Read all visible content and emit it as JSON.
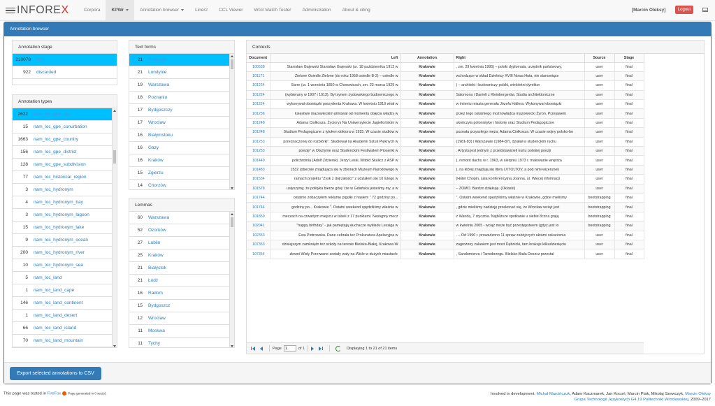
{
  "navbar": {
    "brand": "INFOREX",
    "items": [
      {
        "label": "Corpora"
      },
      {
        "label": "KPWr"
      },
      {
        "label": "Annotation browser"
      },
      {
        "label": "Liner2"
      },
      {
        "label": "CCL Viewer"
      },
      {
        "label": "Wccl Match Tester"
      },
      {
        "label": "Administration"
      },
      {
        "label": "About & citing"
      }
    ],
    "user": "[Marcin Oleksy]",
    "logout": "Logout"
  },
  "panel": {
    "title": "Annotation browser",
    "export_label": "Export selected annotations to CSV"
  },
  "annotation_stage": {
    "title": "Annotation stage",
    "items": [
      {
        "count": "210078",
        "label": "final"
      },
      {
        "count": "922",
        "label": "discarded"
      }
    ]
  },
  "annotation_types": {
    "title": "Annotation types",
    "items": [
      {
        "count": "2622",
        "label": "nam_loc_gpe_city"
      },
      {
        "count": "15",
        "label": "nam_loc_gpe_conurbation"
      },
      {
        "count": "1663",
        "label": "nam_loc_gpe_country"
      },
      {
        "count": "156",
        "label": "nam_loc_gpe_district"
      },
      {
        "count": "128",
        "label": "nam_loc_gpe_subdivision"
      },
      {
        "count": "77",
        "label": "nam_loc_historical_region"
      },
      {
        "count": "3",
        "label": "nam_loc_hydronym"
      },
      {
        "count": "4",
        "label": "nam_loc_hydronym_bay"
      },
      {
        "count": "3",
        "label": "nam_loc_hydronym_lagoon"
      },
      {
        "count": "15",
        "label": "nam_loc_hydronym_lake"
      },
      {
        "count": "9",
        "label": "nam_loc_hydronym_ocean"
      },
      {
        "count": "200",
        "label": "nam_loc_hydronym_river"
      },
      {
        "count": "10",
        "label": "nam_loc_hydronym_sea"
      },
      {
        "count": "5",
        "label": "nam_loc_land"
      },
      {
        "count": "1",
        "label": "nam_loc_land_cape"
      },
      {
        "count": "146",
        "label": "nam_loc_land_continent"
      },
      {
        "count": "1",
        "label": "nam_loc_land_desert"
      },
      {
        "count": "66",
        "label": "nam_loc_land_island"
      },
      {
        "count": "70",
        "label": "nam_loc_land_mountain"
      }
    ]
  },
  "text_forms": {
    "title": "Text forms",
    "items": [
      {
        "count": "21",
        "label": "Krakowie"
      },
      {
        "count": "21",
        "label": "Londynie"
      },
      {
        "count": "19",
        "label": "Warszawa"
      },
      {
        "count": "18",
        "label": "Poznaniu"
      },
      {
        "count": "17",
        "label": "Bydgoszczy"
      },
      {
        "count": "17",
        "label": "Wrocław"
      },
      {
        "count": "16",
        "label": "Białymstoku"
      },
      {
        "count": "16",
        "label": "Gazy"
      },
      {
        "count": "16",
        "label": "Kraków"
      },
      {
        "count": "15",
        "label": "Zgierzu"
      },
      {
        "count": "14",
        "label": "Chorzów"
      }
    ]
  },
  "lemmas": {
    "title": "Lemmas",
    "items": [
      {
        "count": "60",
        "label": "Warszawa"
      },
      {
        "count": "52",
        "label": "Ozorków"
      },
      {
        "count": "27",
        "label": "Lublin"
      },
      {
        "count": "25",
        "label": "Kraków"
      },
      {
        "count": "21",
        "label": "Białystok"
      },
      {
        "count": "21",
        "label": "Łódź"
      },
      {
        "count": "16",
        "label": "Radom"
      },
      {
        "count": "15",
        "label": "Bydgoszcz"
      },
      {
        "count": "12",
        "label": "Wrocław"
      },
      {
        "count": "11",
        "label": "Moskwa"
      },
      {
        "count": "11",
        "label": "Tychy"
      }
    ]
  },
  "contexts": {
    "title": "Contexts",
    "columns": {
      "document": "Document",
      "left": "Left",
      "annotation": "Annotation",
      "right": "Right",
      "source": "Source",
      "stage": "Stage"
    },
    "rows": [
      {
        "doc": "100538",
        "left": "Stanisław Gajewski Stanisław Gajewski (ur. 18 października 1912 w",
        "ann": "Krakowie",
        "right": ", zm. 29 kwietnia 1995) – polski dyplomata, urzędnik państwowy,",
        "src": "user",
        "stage": "final"
      },
      {
        "doc": "101171",
        "left": "Zielone Osiedle Zielone (do roku 1958 osiedle B-2) – osiedle w",
        "ann": "Krakowie",
        "right": "wchodzące w skład Dzielnicy XVIII Nowa Huta, nie stanowiące",
        "src": "user",
        "stage": "final"
      },
      {
        "doc": "101224",
        "left": "Sarre (ur. 1 września 1850 w Chorowicach, zm. 23 marca 1929 w",
        "ann": "Krakowie",
        "right": ") – architekt i budowniczy polski, wieloletni dyrektor",
        "src": "user",
        "stage": "final"
      },
      {
        "doc": "101224",
        "left": "(wybierany w 1907 i 1913). Był synem żydowskiego budowniczego w",
        "ann": "Krakowie",
        "right": "Salomona i Danieli z Kleinbergerów. Studia architektoniczne",
        "src": "user",
        "stage": "final"
      },
      {
        "doc": "101224",
        "left": "wykonywał obowiązki prezydenta Krakowa. W kwietniu 1919 witał w",
        "ann": "Krakowie",
        "right": "w imieniu miasta generała Józefa Hallera. Wykonywał obowiązki",
        "src": "user",
        "stage": "final"
      },
      {
        "doc": "101236",
        "left": "księstwie mazowieckim pilnował od momentu objęcia władzy w",
        "ann": "Krakowie",
        "right": "przez tego ostatniego możnowładca mazowiecki Żyron. Przejawem",
        "src": "user",
        "stage": "final"
      },
      {
        "doc": "101248",
        "left": "Adama Ciołkosza. Życiorys Na Uniwersytecie Jagiellońskim w",
        "ann": "Krakowie",
        "right": "ukończyła polonistykę i historię oraz Studium Pedagogiczne",
        "src": "user",
        "stage": "final"
      },
      {
        "doc": "101248",
        "left": "Studium Pedagogiczne z tytułem doktora w 1925. W czasie studiów w",
        "ann": "Krakowie",
        "right": "poznała przyszłego męża, Adama Ciołkosza. W czasie wojny polsko-bo",
        "src": "user",
        "stage": "final"
      },
      {
        "doc": "101253",
        "left": "przeznaczonej do rozbiórki\". Studiował na Akademii Sztuk Pięknych w",
        "ann": "Krakowie",
        "right": "(1981-83) i Warszawie (1984-87), działał w studenckim ruchu",
        "src": "user",
        "stage": "final"
      },
      {
        "doc": "101253",
        "left": "poezję\" w Olsztynie oraz Studenckim Festiwalem Piosenki w",
        "ann": "Krakowie",
        "right": ". Artysta jest jednym z przedstawicieli nurtu polskiej poezji",
        "src": "user",
        "stage": "final"
      },
      {
        "doc": "101449",
        "left": "polichromia (Adolf Zdzierski, Jerzy Leski, Witold Skulicz z ASP w",
        "ann": "Krakowie",
        "right": "), remont dachu w r. 1963, w sierpniu 1973 r. malowanie wnętrza",
        "src": "user",
        "stage": "final"
      },
      {
        "doc": "101483",
        "left": "1532 (obecnie znajdująca się w zbiorach Muzeum Narodowego w",
        "ann": "Krakowie",
        "right": "), na której znajdują się litery LVTOLTOV, a pod nimi wizerunek",
        "src": "user",
        "stage": "final"
      },
      {
        "doc": "101534",
        "left": "ramach projektu \"Zysk z dojrzałości\" z udziałem się 10 lutego w",
        "ann": "Krakowie",
        "right": "(Hotel Chopin, sala konferencyjna Joanna, ul. Więcej informacji",
        "src": "user",
        "stage": "final"
      },
      {
        "doc": "101578",
        "left": "usłyszymy, że polityka bierze górę i że w Gdańsku jesteśmy my, a w",
        "ann": "Krakowie",
        "right": "– ZOMO. Bardzo dziękuję. (Oklaski)",
        "src": "user",
        "stage": "final"
      },
      {
        "doc": "101744",
        "left": "ostatnio zobaczyłem reklamę pigułki z hasłem \" 72 godziny po...",
        "ann": "Krakowie",
        "right": "\". Ostatni weekend spędziliśmy właśnie w Krakowie, gdzie mieliśmy",
        "src": "bootstrapping",
        "stage": "final"
      },
      {
        "doc": "101744",
        "left": "godziny po... Krakowie \". Ostatni weekend spędziliśmy właśnie w",
        "ann": "Krakowie",
        "right": ", gdzie mieliśmy nadzieję przekonać się, że Wrocław wciąż jest",
        "src": "bootstrapping",
        "stage": "final"
      },
      {
        "doc": "101859",
        "left": "meczach na czwartym miejscu w tabeli z 17 punktami. Następny mecz",
        "ann": "Krakowie",
        "right": "z Wandą, 7 stycznia. Najbliższe spotkanie u siebie 8czna grają",
        "src": "bootstrapping",
        "stage": "final"
      },
      {
        "doc": "102041",
        "left": "\"happy birthday\" - jak pamiętają słuchacze wykładu Lessiga w",
        "ann": "Krakowie",
        "right": "w kwietniu 2005 - wciąż może być przestępstwem (gdyż jest to",
        "src": "bootstrapping",
        "stage": "final"
      },
      {
        "doc": "102353",
        "left": "Ewa Piotrowska. Dane zebrała też Prokuratura Apelacyjna w",
        "ann": "Krakowie",
        "right": ". – Od 1990 r. prowadzono 11 spraw zabójczych aktami oskarżenia",
        "src": "user",
        "stage": "final"
      },
      {
        "doc": "107353",
        "left": "dzisiejszym zamknięto też szkoły na terenie Bielska-Białej, Krakowa W",
        "ann": "Krakowie",
        "right": "zagrożony zalaniem jest most Dębnicki, tam brakuje kilkudziesięciu",
        "src": "user",
        "stage": "final"
      },
      {
        "doc": "107354",
        "left": "zlewni Wisły Przerwane zostały wały na Wiśle w dużych miastach:",
        "ann": "Krakowie",
        "right": ", Sandomierzu i Tarnobrzegu. Bielsko-Biała Deszcz przestał",
        "src": "user",
        "stage": "final"
      }
    ],
    "pager": {
      "page_label": "Page",
      "page_value": "1",
      "of_label": "of 1",
      "display": "Displaying 1 to 21 of 21 items"
    }
  },
  "footer": {
    "tested": "This page was tested in",
    "firefox": "FireFox",
    "generated": ". Page generated in 0 sec(s).",
    "involved": "Involved in development:",
    "dev1": "Michał Marcińczuk",
    "others": ", Adam Kaczmarek, Jan Kocoń, Marcin Ptak, Mikołaj Szewczyk,",
    "dev2": "Marcin Oleksy",
    "group": "Grupa Technologii Językowych G4.19 Politechniki Wrocławskiej",
    "years": ", 2009–2017"
  }
}
